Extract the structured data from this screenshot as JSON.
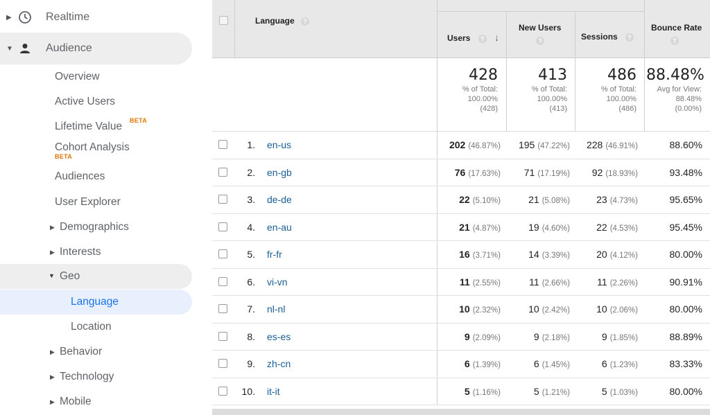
{
  "sidebar": {
    "realtime": "Realtime",
    "audience": "Audience",
    "items": {
      "overview": "Overview",
      "active_users": "Active Users",
      "lifetime_value": "Lifetime Value",
      "cohort_analysis": "Cohort Analysis",
      "audiences": "Audiences",
      "user_explorer": "User Explorer",
      "demographics": "Demographics",
      "interests": "Interests",
      "geo": "Geo",
      "language": "Language",
      "location": "Location",
      "behavior": "Behavior",
      "technology": "Technology",
      "mobile": "Mobile"
    },
    "beta": "BETA"
  },
  "table": {
    "headers": {
      "language": "Language",
      "users": "Users",
      "new_users": "New Users",
      "sessions": "Sessions",
      "bounce_rate": "Bounce Rate"
    },
    "totals": {
      "users": {
        "value": "428",
        "l1": "% of Total:",
        "l2": "100.00%",
        "l3": "(428)"
      },
      "new_users": {
        "value": "413",
        "l1": "% of Total:",
        "l2": "100.00%",
        "l3": "(413)"
      },
      "sessions": {
        "value": "486",
        "l1": "% of Total:",
        "l2": "100.00%",
        "l3": "(486)"
      },
      "bounce_rate": {
        "value": "88.48%",
        "l1": "Avg for View:",
        "l2": "88.48%",
        "l3": "(0.00%)"
      }
    },
    "rows": [
      {
        "num": "1.",
        "lang": "en-us",
        "users": "202",
        "users_pct": "(46.87%)",
        "new_users": "195",
        "new_users_pct": "(47.22%)",
        "sessions": "228",
        "sessions_pct": "(46.91%)",
        "bounce": "88.60%"
      },
      {
        "num": "2.",
        "lang": "en-gb",
        "users": "76",
        "users_pct": "(17.63%)",
        "new_users": "71",
        "new_users_pct": "(17.19%)",
        "sessions": "92",
        "sessions_pct": "(18.93%)",
        "bounce": "93.48%"
      },
      {
        "num": "3.",
        "lang": "de-de",
        "users": "22",
        "users_pct": "(5.10%)",
        "new_users": "21",
        "new_users_pct": "(5.08%)",
        "sessions": "23",
        "sessions_pct": "(4.73%)",
        "bounce": "95.65%"
      },
      {
        "num": "4.",
        "lang": "en-au",
        "users": "21",
        "users_pct": "(4.87%)",
        "new_users": "19",
        "new_users_pct": "(4.60%)",
        "sessions": "22",
        "sessions_pct": "(4.53%)",
        "bounce": "95.45%"
      },
      {
        "num": "5.",
        "lang": "fr-fr",
        "users": "16",
        "users_pct": "(3.71%)",
        "new_users": "14",
        "new_users_pct": "(3.39%)",
        "sessions": "20",
        "sessions_pct": "(4.12%)",
        "bounce": "80.00%"
      },
      {
        "num": "6.",
        "lang": "vi-vn",
        "users": "11",
        "users_pct": "(2.55%)",
        "new_users": "11",
        "new_users_pct": "(2.66%)",
        "sessions": "11",
        "sessions_pct": "(2.26%)",
        "bounce": "90.91%"
      },
      {
        "num": "7.",
        "lang": "nl-nl",
        "users": "10",
        "users_pct": "(2.32%)",
        "new_users": "10",
        "new_users_pct": "(2.42%)",
        "sessions": "10",
        "sessions_pct": "(2.06%)",
        "bounce": "80.00%"
      },
      {
        "num": "8.",
        "lang": "es-es",
        "users": "9",
        "users_pct": "(2.09%)",
        "new_users": "9",
        "new_users_pct": "(2.18%)",
        "sessions": "9",
        "sessions_pct": "(1.85%)",
        "bounce": "88.89%"
      },
      {
        "num": "9.",
        "lang": "zh-cn",
        "users": "6",
        "users_pct": "(1.39%)",
        "new_users": "6",
        "new_users_pct": "(1.45%)",
        "sessions": "6",
        "sessions_pct": "(1.23%)",
        "bounce": "83.33%"
      },
      {
        "num": "10.",
        "lang": "it-it",
        "users": "5",
        "users_pct": "(1.16%)",
        "new_users": "5",
        "new_users_pct": "(1.21%)",
        "sessions": "5",
        "sessions_pct": "(1.03%)",
        "bounce": "80.00%"
      }
    ]
  },
  "colors": {
    "link": "#1a5e95",
    "beta": "#e37400",
    "selected_bg": "#e8f0fe",
    "header_bg": "#e8e8e8"
  }
}
